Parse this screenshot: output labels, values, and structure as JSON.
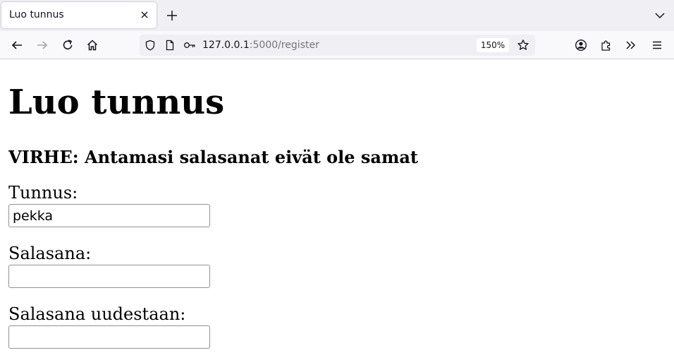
{
  "tab": {
    "title": "Luo tunnus"
  },
  "address_bar": {
    "host": "127.0.0.1",
    "path": ":5000/register",
    "zoom": "150%"
  },
  "page": {
    "heading": "Luo tunnus",
    "error": "VIRHE: Antamasi salasanat eivät ole samat",
    "form": {
      "username_label": "Tunnus:",
      "username_value": "pekka",
      "password_label": "Salasana:",
      "password_value": "",
      "password2_label": "Salasana uudestaan:",
      "password2_value": ""
    }
  }
}
